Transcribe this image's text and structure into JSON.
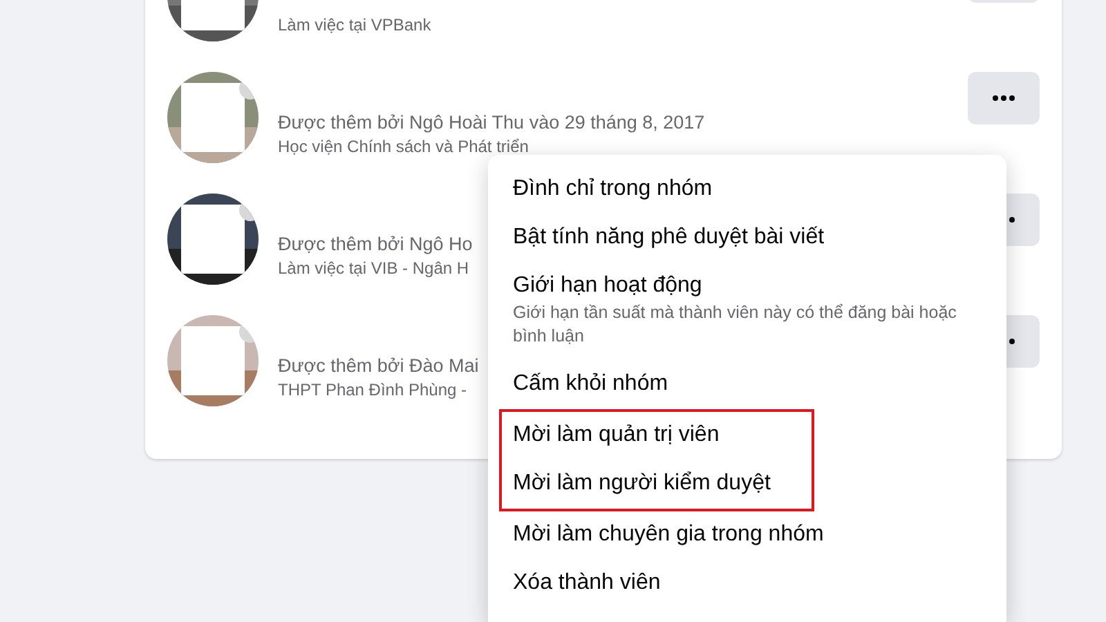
{
  "members": [
    {
      "detail": "Làm việc tại VPBank"
    },
    {
      "name": "Được thêm bởi Ngô Hoài Thu vào 29 tháng 8, 2017",
      "detail": "Học viện Chính sách và Phát triển"
    },
    {
      "name": "Được thêm bởi Ngô Ho",
      "detail": "Làm việc tại VIB - Ngân H"
    },
    {
      "name": "Được thêm bởi Đào Mai",
      "detail": "THPT Phan Đình Phùng -"
    }
  ],
  "menu": {
    "items": [
      {
        "label": "Đình chỉ trong nhóm",
        "highlighted": false
      },
      {
        "label": "Bật tính năng phê duyệt bài viết",
        "highlighted": false
      },
      {
        "label": "Giới hạn hoạt động",
        "description": "Giới hạn tần suất mà thành viên này có thể đăng bài hoặc bình luận",
        "highlighted": false
      },
      {
        "label": "Cấm khỏi nhóm",
        "highlighted": false
      },
      {
        "label": "Mời làm quản trị viên",
        "highlighted": true
      },
      {
        "label": "Mời làm người kiểm duyệt",
        "highlighted": true
      },
      {
        "label": "Mời làm chuyên gia trong nhóm",
        "highlighted": false
      },
      {
        "label": "Xóa thành viên",
        "highlighted": false
      }
    ]
  }
}
